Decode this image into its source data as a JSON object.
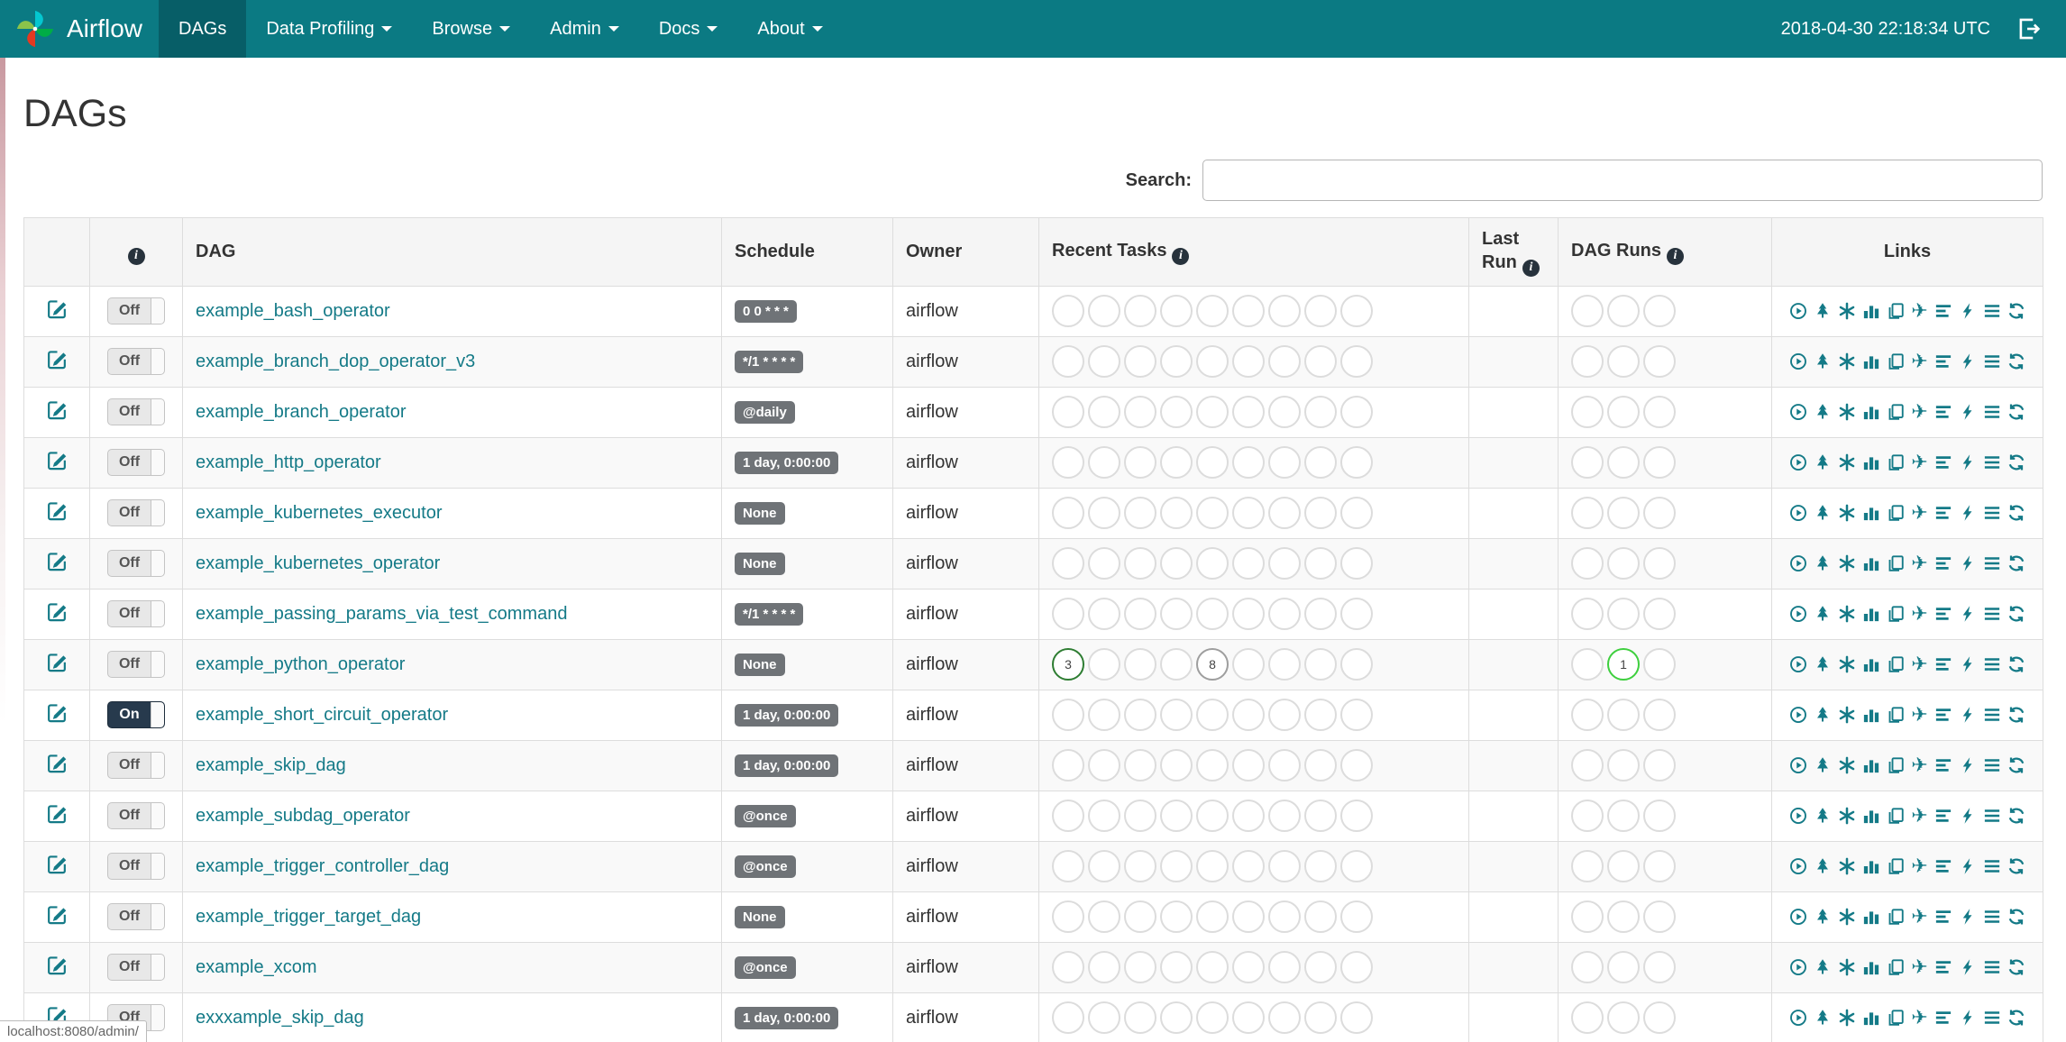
{
  "navbar": {
    "brand": "Airflow",
    "items": [
      {
        "label": "DAGs",
        "active": true,
        "caret": false
      },
      {
        "label": "Data Profiling",
        "active": false,
        "caret": true
      },
      {
        "label": "Browse",
        "active": false,
        "caret": true
      },
      {
        "label": "Admin",
        "active": false,
        "caret": true
      },
      {
        "label": "Docs",
        "active": false,
        "caret": true
      },
      {
        "label": "About",
        "active": false,
        "caret": true
      }
    ],
    "clock": "2018-04-30 22:18:34 UTC"
  },
  "page": {
    "title": "DAGs"
  },
  "search": {
    "label": "Search:",
    "value": ""
  },
  "table": {
    "headers": {
      "edit": "",
      "info": "",
      "dag": "DAG",
      "schedule": "Schedule",
      "owner": "Owner",
      "recent_tasks": "Recent Tasks",
      "last_run": "Last Run",
      "dag_runs": "DAG Runs",
      "links": "Links"
    },
    "links_icons": [
      "trigger-dag",
      "tree-view",
      "graph-view",
      "task-duration",
      "task-tries",
      "landing-times",
      "gantt-view",
      "code-view",
      "logs",
      "refresh"
    ]
  },
  "toggle": {
    "on_label": "On",
    "off_label": "Off"
  },
  "status_bar": {
    "url": "localhost:8080/admin/"
  },
  "colors": {
    "navbar_bg": "#0b7a83",
    "navbar_active_bg": "#075e67",
    "link_teal": "#147a87",
    "badge_grey": "#6f7377",
    "toggle_on_bg": "#273a4d",
    "state_success_green": "#2e7d32",
    "state_grey": "#9e9e9e",
    "state_running_green": "#3ecf3e"
  },
  "dags": [
    {
      "name": "example_bash_operator",
      "schedule": "0 0 * * *",
      "owner": "airflow",
      "enabled": false
    },
    {
      "name": "example_branch_dop_operator_v3",
      "schedule": "*/1 * * * *",
      "owner": "airflow",
      "enabled": false
    },
    {
      "name": "example_branch_operator",
      "schedule": "@daily",
      "owner": "airflow",
      "enabled": false
    },
    {
      "name": "example_http_operator",
      "schedule": "1 day, 0:00:00",
      "owner": "airflow",
      "enabled": false
    },
    {
      "name": "example_kubernetes_executor",
      "schedule": "None",
      "owner": "airflow",
      "enabled": false
    },
    {
      "name": "example_kubernetes_operator",
      "schedule": "None",
      "owner": "airflow",
      "enabled": false
    },
    {
      "name": "example_passing_params_via_test_command",
      "schedule": "*/1 * * * *",
      "owner": "airflow",
      "enabled": false
    },
    {
      "name": "example_python_operator",
      "schedule": "None",
      "owner": "airflow",
      "enabled": false,
      "recent_tasks": {
        "0": {
          "count": "3",
          "color": "#2e7d32"
        },
        "4": {
          "count": "8",
          "color": "#9e9e9e"
        }
      },
      "dag_runs": {
        "1": {
          "count": "1",
          "color": "#3ecf3e"
        }
      }
    },
    {
      "name": "example_short_circuit_operator",
      "schedule": "1 day, 0:00:00",
      "owner": "airflow",
      "enabled": true
    },
    {
      "name": "example_skip_dag",
      "schedule": "1 day, 0:00:00",
      "owner": "airflow",
      "enabled": false
    },
    {
      "name": "example_subdag_operator",
      "schedule": "@once",
      "owner": "airflow",
      "enabled": false
    },
    {
      "name": "example_trigger_controller_dag",
      "schedule": "@once",
      "owner": "airflow",
      "enabled": false
    },
    {
      "name": "example_trigger_target_dag",
      "schedule": "None",
      "owner": "airflow",
      "enabled": false
    },
    {
      "name": "example_xcom",
      "schedule": "@once",
      "owner": "airflow",
      "enabled": false
    },
    {
      "name": "exxxample_skip_dag",
      "schedule": "1 day, 0:00:00",
      "owner": "airflow",
      "enabled": false
    }
  ]
}
